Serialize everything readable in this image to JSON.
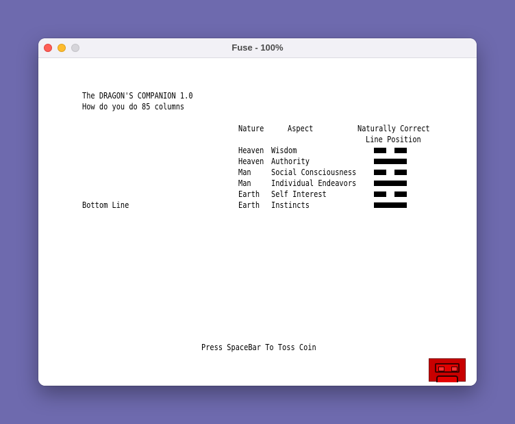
{
  "window": {
    "title": "Fuse - 100%"
  },
  "screen": {
    "header_line1": "The DRAGON'S COMPANION 1.0",
    "header_line2": "How do you do 85 columns",
    "col_nature": "Nature",
    "col_aspect": "Aspect",
    "col_correct_1": "Naturally Correct",
    "col_correct_2": "Line Position",
    "bottom_line_label": "Bottom Line",
    "rows": [
      {
        "nature": "Heaven",
        "aspect": "Wisdom",
        "line": "broken"
      },
      {
        "nature": "Heaven",
        "aspect": "Authority",
        "line": "solid"
      },
      {
        "nature": "Man",
        "aspect": "Social Consciousness",
        "line": "broken"
      },
      {
        "nature": "Man",
        "aspect": "Individual Endeavors",
        "line": "solid"
      },
      {
        "nature": "Earth",
        "aspect": "Self Interest",
        "line": "broken"
      },
      {
        "nature": "Earth",
        "aspect": "Instincts",
        "line": "solid"
      }
    ],
    "prompt": "Press SpaceBar To Toss Coin"
  },
  "colors": {
    "desktop": "#6e6aae",
    "badge": "#c80000"
  },
  "icons": {
    "badge": "red-robot-icon"
  }
}
